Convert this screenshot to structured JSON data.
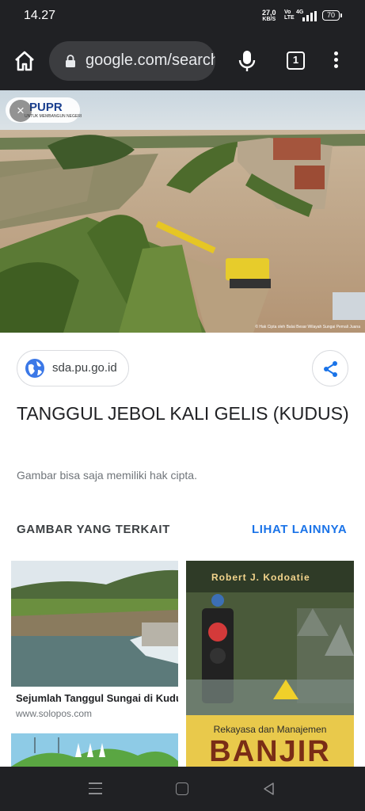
{
  "status_bar": {
    "time": "14.27",
    "net_speed_value": "27,0",
    "net_speed_unit": "KB/S",
    "volte_top": "Vo",
    "volte_bottom": "LTE",
    "network": "4G",
    "battery": "70"
  },
  "browser": {
    "url": "google.com/search",
    "tab_count": "1"
  },
  "hero": {
    "logo_text": "PUPR",
    "logo_sub": "UNTUK MEMBANGUN NEGERI",
    "close_icon": "×",
    "photo_credit": "© Hak Cipta oleh Balai Besar Wilayah Sungai Pemali Juana"
  },
  "result": {
    "source": "sda.pu.go.id",
    "title": "TANGGUL JEBOL KALI GELIS (KUDUS)",
    "copyright_note": "Gambar bisa saja memiliki hak cipta."
  },
  "related": {
    "heading": "GAMBAR YANG TERKAIT",
    "see_more": "LIHAT LAINNYA",
    "items": [
      {
        "title": "Sejumlah Tanggul Sungai di Kudus Jebol",
        "source": "www.solopos.com"
      },
      {
        "author": "Robert J. Kodoatie",
        "subtitle": "Rekayasa dan Manajemen",
        "book_title": "BANJIR"
      }
    ]
  },
  "icons": {
    "home": "home-icon",
    "lock": "lock-icon",
    "mic": "mic-icon",
    "tabs": "tabs-icon",
    "menu": "more-vert-icon",
    "globe": "globe-icon",
    "share": "share-icon"
  },
  "colors": {
    "chrome_bar": "#202124",
    "link_blue": "#1a73e8",
    "text_primary": "#202124",
    "text_secondary": "#70757a"
  }
}
